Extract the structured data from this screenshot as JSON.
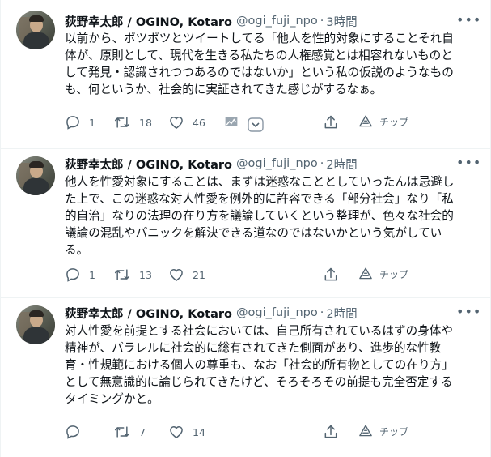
{
  "tweets": [
    {
      "author_name": "荻野幸太郎 / OGINO, Kotaro",
      "handle": "@ogi_fuji_npo",
      "separator": "·",
      "time": "3時間",
      "text": "以前から、ポツポツとツイートしてる「他人を性的対象にすることそれ自\n体が、原則として、現代を生きる私たちの人権感覚とは相容れないものと\nして発見・認識されつつあるのではないか」という私の仮説のようなもの\nも、何というか、社会的に実証されてきた感じがするなぁ。",
      "replies": "1",
      "retweets": "18",
      "likes": "46",
      "tip_label": "チップ"
    },
    {
      "author_name": "荻野幸太郎 / OGINO, Kotaro",
      "handle": "@ogi_fuji_npo",
      "separator": "·",
      "time": "2時間",
      "text": "他人を性愛対象にすることは、まずは迷惑なこととしていったんは忌避し\nた上で、この迷惑な対人性愛を例外的に許容できる「部分社会」なり「私\n的自治」なりの法理の在り方を議論していくという整理が、色々な社会的\n議論の混乱やパニックを解決できる道なのではないかという気がしてい\nる。",
      "replies": "1",
      "retweets": "13",
      "likes": "21",
      "tip_label": "チップ"
    },
    {
      "author_name": "荻野幸太郎 / OGINO, Kotaro",
      "handle": "@ogi_fuji_npo",
      "separator": "·",
      "time": "2時間",
      "text": "対人性愛を前提とする社会においては、自己所有されているはずの身体や\n精神が、パラレルに社会的に総有されてきた側面があり、進歩的な性教\n育・性規範における個人の尊重も、なお「社会的所有物としての在り方」\nとして無意識的に論じられてきたけど、そろそろその前提も完全否定する\nタイミングかと。",
      "replies": "",
      "retweets": "7",
      "likes": "14",
      "tip_label": "チップ"
    }
  ],
  "icons": {
    "more": "more-horizontal-icon",
    "reply": "reply-icon",
    "retweet": "retweet-icon",
    "like": "heart-icon",
    "analytics": "analytics-icon",
    "dropdown": "chevron-down-icon",
    "share": "share-icon",
    "tip": "tip-icon"
  },
  "colors": {
    "text": "#0f1419",
    "secondary": "#536471",
    "border": "#eff3f4"
  }
}
